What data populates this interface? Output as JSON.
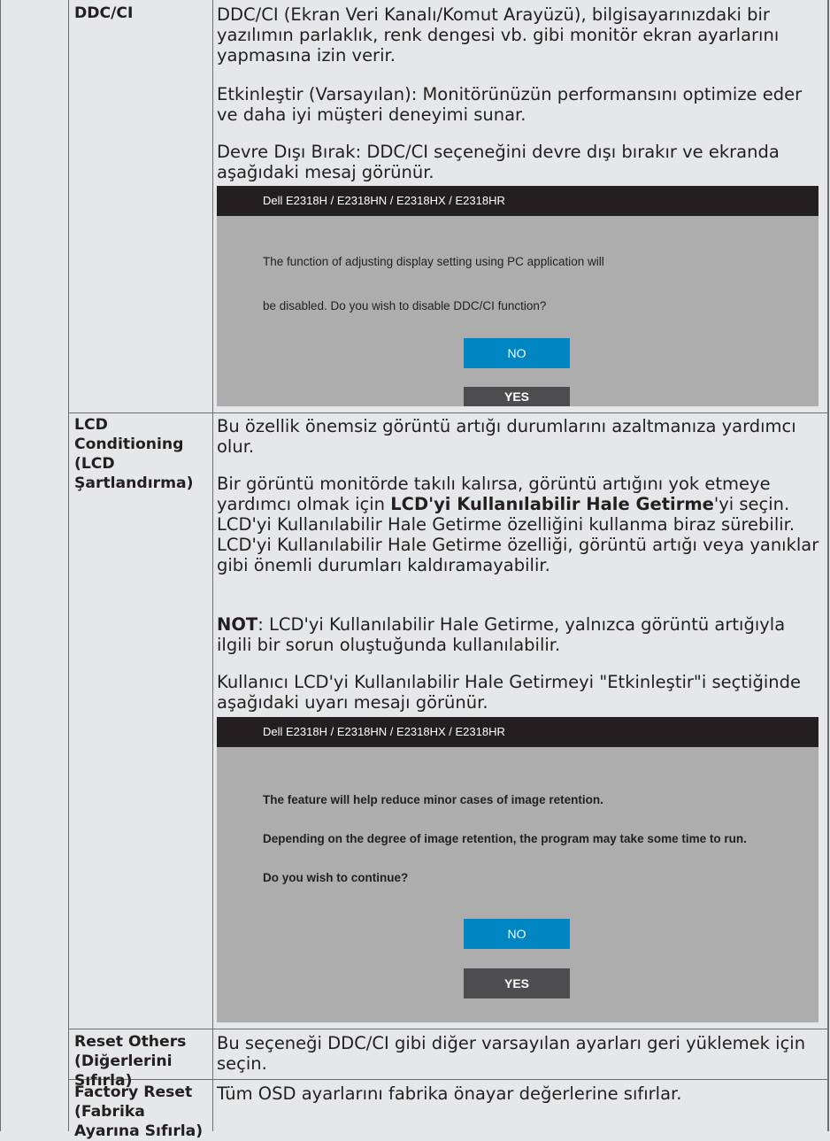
{
  "rows": [
    {
      "label": [
        "DDC/CI"
      ],
      "paragraphs": [
        "DDC/CI (Ekran Veri Kanalı/Komut Arayüzü), bilgisayarınızdaki bir yazılımın parlaklık, renk dengesi vb. gibi monitör ekran ayarlarını yapmasına izin verir.",
        "Etkinleştir (Varsayılan): Monitörünüzün performansını optimize eder ve daha iyi müşteri deneyimi sunar.",
        "Devre Dışı Bırak: DDC/CI seçeneğini devre dışı bırakır ve ekranda aşağıdaki mesaj görünür."
      ],
      "dialog": {
        "title": "Dell  E2318H / E2318HN / E2318HX / E2318HR",
        "messages": [
          "The function of adjusting display setting using PC application will",
          "be disabled. Do you wish to disable DDC/CI function?"
        ],
        "no_label": "NO",
        "yes_label": "YES"
      }
    },
    {
      "label": [
        "LCD",
        "Conditioning",
        "(LCD",
        "Şartlandırma)"
      ],
      "p1": "Bu özellik önemsiz görüntü artığı durumlarını azaltmanıza yardımcı olur.",
      "p2_a": "Bir görüntü monitörde takılı kalırsa, görüntü artığını yok etmeye yardımcı olmak için ",
      "p2_b": "LCD'yi Kullanılabilir Hale Getirme",
      "p2_c": "'yi seçin. LCD'yi Kullanılabilir Hale Getirme özelliğini kullanma biraz sürebilir. LCD'yi Kullanılabilir Hale Getirme özelliği, görüntü artığı veya yanıklar gibi önemli durumları kaldıramayabilir.",
      "p3_a": "NOT",
      "p3_b": ": LCD'yi Kullanılabilir Hale Getirme, yalnızca görüntü artığıyla ilgili bir sorun oluştuğunda kullanılabilir.",
      "p4": "Kullanıcı LCD'yi Kullanılabilir Hale Getirmeyi \"Etkinleştir\"i seçtiğinde aşağıdaki uyarı mesajı görünür.",
      "dialog": {
        "title": "Dell  E2318H / E2318HN / E2318HX / E2318HR",
        "messages": [
          "The feature will help reduce minor cases of image retention.",
          "Depending on the degree of image retention, the program may take some time to run.",
          "Do you wish to continue?"
        ],
        "no_label": "NO",
        "yes_label": "YES"
      }
    },
    {
      "label": [
        "Reset Others",
        "(Diğerlerini",
        "Sıfırla)"
      ],
      "paragraph": "Bu seçeneği DDC/CI gibi diğer varsayılan ayarları geri yüklemek için seçin."
    },
    {
      "label": [
        "Factory Reset",
        "(Fabrika",
        "Ayarına Sıfırla)"
      ],
      "paragraph": "Tüm OSD ayarlarını fabrika önayar değerlerine sıfırlar."
    }
  ]
}
